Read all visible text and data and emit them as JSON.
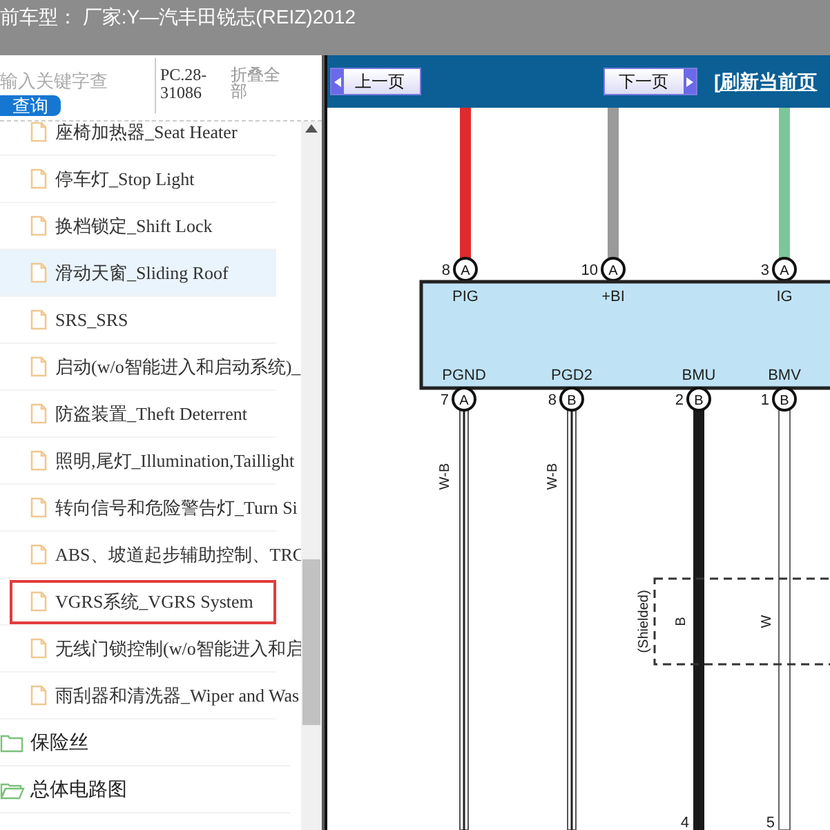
{
  "header": {
    "title": "前车型： 厂家:Y—汽丰田锐志(REIZ)2012"
  },
  "search": {
    "placeholder": "输入关键字查",
    "button": "查询"
  },
  "code": "PC.28-31086",
  "collapse_all": "折叠全部",
  "tree": [
    {
      "kind": "file",
      "label": "座椅加热器_Seat Heater",
      "selected": false,
      "highlighted": false
    },
    {
      "kind": "file",
      "label": "停车灯_Stop Light",
      "selected": false,
      "highlighted": false
    },
    {
      "kind": "file",
      "label": "换档锁定_Shift Lock",
      "selected": false,
      "highlighted": false
    },
    {
      "kind": "file",
      "label": "滑动天窗_Sliding Roof",
      "selected": true,
      "highlighted": false
    },
    {
      "kind": "file",
      "label": "SRS_SRS",
      "selected": false,
      "highlighted": false
    },
    {
      "kind": "file",
      "label": "启动(w/o智能进入和启动系统)_",
      "selected": false,
      "highlighted": false
    },
    {
      "kind": "file",
      "label": "防盗装置_Theft Deterrent",
      "selected": false,
      "highlighted": false
    },
    {
      "kind": "file",
      "label": "照明,尾灯_Illumination,Taillight",
      "selected": false,
      "highlighted": false
    },
    {
      "kind": "file",
      "label": "转向信号和危险警告灯_Turn Si",
      "selected": false,
      "highlighted": false
    },
    {
      "kind": "file",
      "label": "ABS、坡道起步辅助控制、TRC",
      "selected": false,
      "highlighted": false
    },
    {
      "kind": "file",
      "label": "VGRS系统_VGRS System",
      "selected": false,
      "highlighted": true
    },
    {
      "kind": "file",
      "label": "无线门锁控制(w/o智能进入和启",
      "selected": false,
      "highlighted": false
    },
    {
      "kind": "file",
      "label": "雨刮器和清洗器_Wiper and Was",
      "selected": false,
      "highlighted": false
    },
    {
      "kind": "folder",
      "label": "保险丝",
      "expanded": false
    },
    {
      "kind": "folder",
      "label": "总体电路图",
      "expanded": true
    }
  ],
  "toolbar": {
    "prev": "上一页",
    "next": "下一页",
    "refresh": "[刷新当前页"
  },
  "diagram": {
    "top_pins": [
      {
        "number": "8",
        "connector": "A",
        "name": "PIG",
        "color": "#e02a2e"
      },
      {
        "number": "10",
        "connector": "A",
        "name": "+BI",
        "color": "#9a9a9a"
      },
      {
        "number": "3",
        "connector": "A",
        "name": "IG",
        "color": "#7cc79a"
      }
    ],
    "bottom_pins": [
      {
        "number": "7",
        "connector": "A",
        "name": "PGND",
        "kind": "double",
        "wire_label": "W-B"
      },
      {
        "number": "8",
        "connector": "B",
        "name": "PGD2",
        "kind": "double",
        "wire_label": "W-B"
      },
      {
        "number": "2",
        "connector": "B",
        "name": "BMU",
        "kind": "black",
        "wire_label": "B"
      },
      {
        "number": "1",
        "connector": "B",
        "name": "BMV",
        "kind": "white",
        "wire_label": "W"
      }
    ],
    "shield_label": "(Shielded)",
    "end_numbers": [
      "4",
      "5"
    ]
  }
}
